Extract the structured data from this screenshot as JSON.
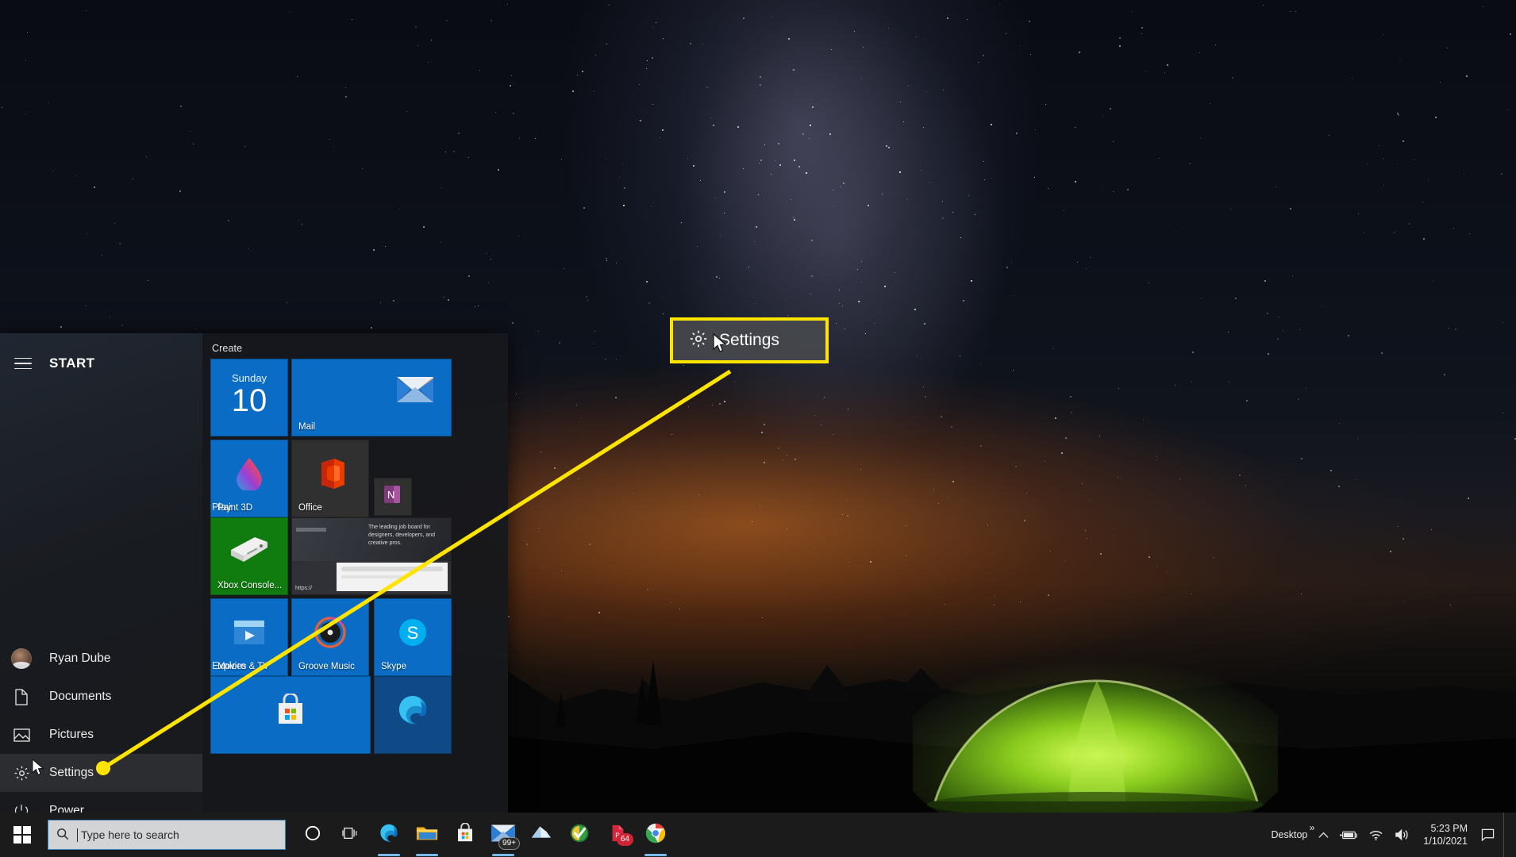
{
  "desktop": {
    "wallpaper_description": "night sky milky way over mountains with glowing green tent"
  },
  "start_menu": {
    "hamburger_icon": "hamburger-menu-icon",
    "title": "START",
    "rail_items": [
      {
        "label": "Ryan Dube",
        "icon": "user-avatar-icon",
        "selected": false
      },
      {
        "label": "Documents",
        "icon": "document-icon",
        "selected": false
      },
      {
        "label": "Pictures",
        "icon": "picture-icon",
        "selected": false
      },
      {
        "label": "Settings",
        "icon": "gear-icon",
        "selected": true
      },
      {
        "label": "Power",
        "icon": "power-icon",
        "selected": false
      }
    ],
    "groups": [
      {
        "title": "Create",
        "tiles": [
          {
            "label": "",
            "day": "Sunday",
            "date": "10",
            "icon": "calendar-tile",
            "color": "#0a6cc4",
            "size": "medium"
          },
          {
            "label": "Mail",
            "icon": "mail-icon",
            "color": "#0a6cc4",
            "size": "wide"
          },
          {
            "label": "Paint 3D",
            "icon": "paint3d-icon",
            "color": "#0a6cc4",
            "size": "medium"
          },
          {
            "label": "Office",
            "icon": "office-icon",
            "color": "#303030",
            "size": "medium"
          },
          {
            "label": "",
            "icon": "onenote-icon",
            "color": "#303030",
            "size": "small"
          }
        ]
      },
      {
        "title": "Play",
        "tiles": [
          {
            "label": "Xbox Console...",
            "icon": "xbox-console-icon",
            "color": "#107c10",
            "size": "medium"
          },
          {
            "label": "",
            "icon": "web-preview-tile",
            "color": "#2f3136",
            "size": "wide",
            "preview_text": "The leading job board for designers, developers, and creative pros."
          },
          {
            "label": "Movies & TV",
            "icon": "movies-tv-icon",
            "color": "#0a6cc4",
            "size": "medium"
          },
          {
            "label": "Groove Music",
            "icon": "groove-music-icon",
            "color": "#0a6cc4",
            "size": "medium"
          },
          {
            "label": "Skype",
            "icon": "skype-icon",
            "color": "#0a6cc4",
            "size": "medium"
          }
        ]
      },
      {
        "title": "Explore",
        "tiles": [
          {
            "label": "",
            "icon": "microsoft-store-icon",
            "color": "#0a6cc4",
            "size": "wide"
          },
          {
            "label": "",
            "icon": "edge-icon",
            "color": "#0f4a86",
            "size": "medium"
          }
        ]
      }
    ]
  },
  "callout": {
    "label": "Settings",
    "icon": "gear-icon",
    "border_color": "#ffe400"
  },
  "taskbar": {
    "start_button_icon": "windows-logo-icon",
    "search": {
      "placeholder": "Type here to search",
      "value": "",
      "icon": "search-icon"
    },
    "buttons": [
      {
        "name": "cortana-button",
        "icon": "cortana-circle-icon",
        "label": "",
        "badge": ""
      },
      {
        "name": "task-view-button",
        "icon": "task-view-icon",
        "label": "",
        "badge": ""
      },
      {
        "name": "edge-button",
        "icon": "edge-icon",
        "label": "",
        "badge": ""
      },
      {
        "name": "file-explorer-button",
        "icon": "folder-icon",
        "label": "",
        "badge": ""
      },
      {
        "name": "microsoft-store-button",
        "icon": "microsoft-store-icon",
        "label": "",
        "badge": ""
      },
      {
        "name": "mail-button",
        "icon": "mail-icon",
        "label": "",
        "badge": "99+"
      },
      {
        "name": "onedrive-button",
        "icon": "onedrive-icon",
        "label": "",
        "badge": ""
      },
      {
        "name": "kaspersky-button",
        "icon": "shield-check-icon",
        "label": "",
        "badge": ""
      },
      {
        "name": "pdf-button",
        "icon": "pdf-icon",
        "label": "",
        "badge": "64"
      },
      {
        "name": "chrome-button",
        "icon": "chrome-icon",
        "label": "",
        "badge": ""
      }
    ],
    "tray": {
      "desktop_label": "Desktop",
      "overflow_icon": "chevron-double-right-icon",
      "hidden_icons_icon": "chevron-up-icon",
      "battery_icon": "battery-icon",
      "network_icon": "wifi-icon",
      "volume_icon": "speaker-icon",
      "time": "5:23 PM",
      "date": "1/10/2021",
      "action_center_icon": "notification-icon"
    }
  }
}
